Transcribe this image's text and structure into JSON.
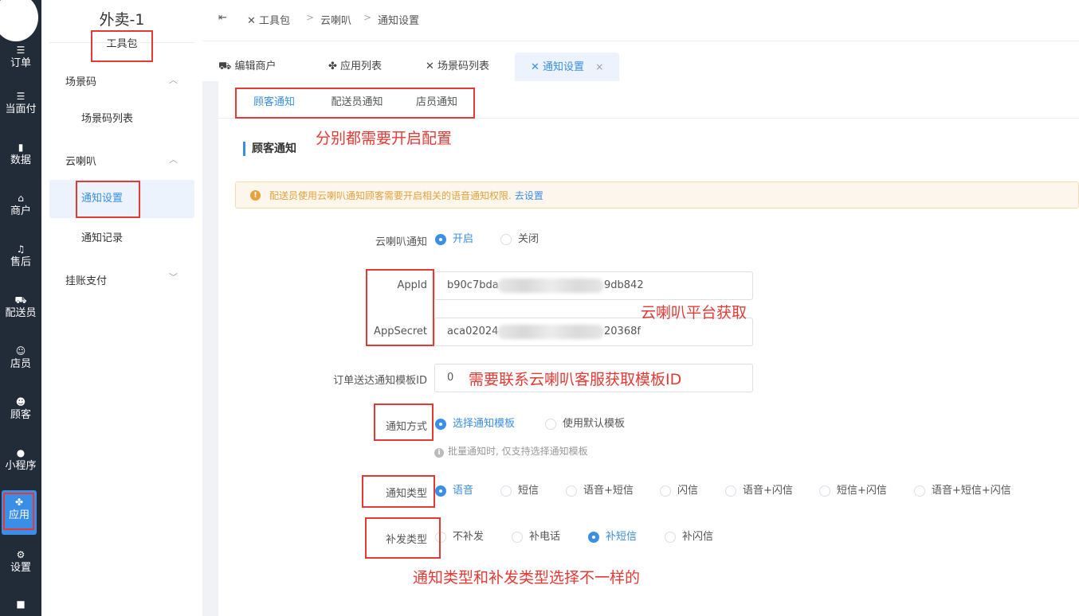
{
  "rail": {
    "items": [
      {
        "label": "订单",
        "icon": "list-icon"
      },
      {
        "label": "当面付",
        "icon": "list-icon"
      },
      {
        "label": "数据",
        "icon": "bar-chart-icon"
      },
      {
        "label": "商户",
        "icon": "store-icon"
      },
      {
        "label": "售后",
        "icon": "headset-icon"
      },
      {
        "label": "配送员",
        "icon": "delivery-icon"
      },
      {
        "label": "店员",
        "icon": "staff-icon"
      },
      {
        "label": "顾客",
        "icon": "customer-icon"
      },
      {
        "label": "小程序",
        "icon": "wechat-icon"
      },
      {
        "label": "应用",
        "icon": "apps-icon"
      },
      {
        "label": "设置",
        "icon": "settings-icon"
      },
      {
        "label": "",
        "icon": "lock-icon"
      }
    ]
  },
  "subnav": {
    "shop_name": "外卖-1",
    "section": "工具包",
    "groups": [
      {
        "label": "场景码",
        "items": [
          "场景码列表"
        ]
      },
      {
        "label": "云喇叭",
        "items": [
          "通知设置",
          "通知记录"
        ]
      },
      {
        "label": "挂账支付",
        "items": []
      }
    ]
  },
  "breadcrumb": [
    "工具包",
    "云喇叭",
    "通知设置"
  ],
  "page_tabs": [
    "编辑商户",
    "应用列表",
    "场景码列表",
    "通知设置"
  ],
  "sub_tabs": [
    "顾客通知",
    "配送员通知",
    "店员通知"
  ],
  "section_title": "顾客通知",
  "alert": {
    "text": "配送员使用云喇叭通知顾客需要开启相关的语音通知权限.",
    "link": "去设置"
  },
  "form": {
    "notify_label": "云喇叭通知",
    "notify_options": [
      "开启",
      "关闭"
    ],
    "notify_selected": "开启",
    "appid_label": "AppId",
    "appid_prefix": "b90c7bda",
    "appid_suffix": "9db842",
    "appsecret_label": "AppSecret",
    "appsecret_prefix": "aca02024",
    "appsecret_suffix": "20368f",
    "template_label": "订单送达通知模板ID",
    "template_value": "0",
    "method_label": "通知方式",
    "method_options": [
      "选择通知模板",
      "使用默认模板"
    ],
    "method_selected": "选择通知模板",
    "method_hint": "批量通知时, 仅支持选择通知模板",
    "type_label": "通知类型",
    "type_options": [
      "语音",
      "短信",
      "语音+短信",
      "闪信",
      "语音+闪信",
      "短信+闪信",
      "语音+短信+闪信"
    ],
    "type_selected": "语音",
    "resend_label": "补发类型",
    "resend_options": [
      "不补发",
      "补电话",
      "补短信",
      "补闪信"
    ],
    "resend_selected": "补短信"
  },
  "annotations": {
    "subtabs_note": "分别都需要开启配置",
    "credentials_note": "云喇叭平台获取",
    "template_note": "需要联系云喇叭客服获取模板ID",
    "type_note": "通知类型和补发类型选择不一样的"
  },
  "colors": {
    "accent": "#3a8ee6",
    "rail_bg": "#222b38",
    "annotation": "#e53935",
    "warning": "#e6a23c"
  }
}
